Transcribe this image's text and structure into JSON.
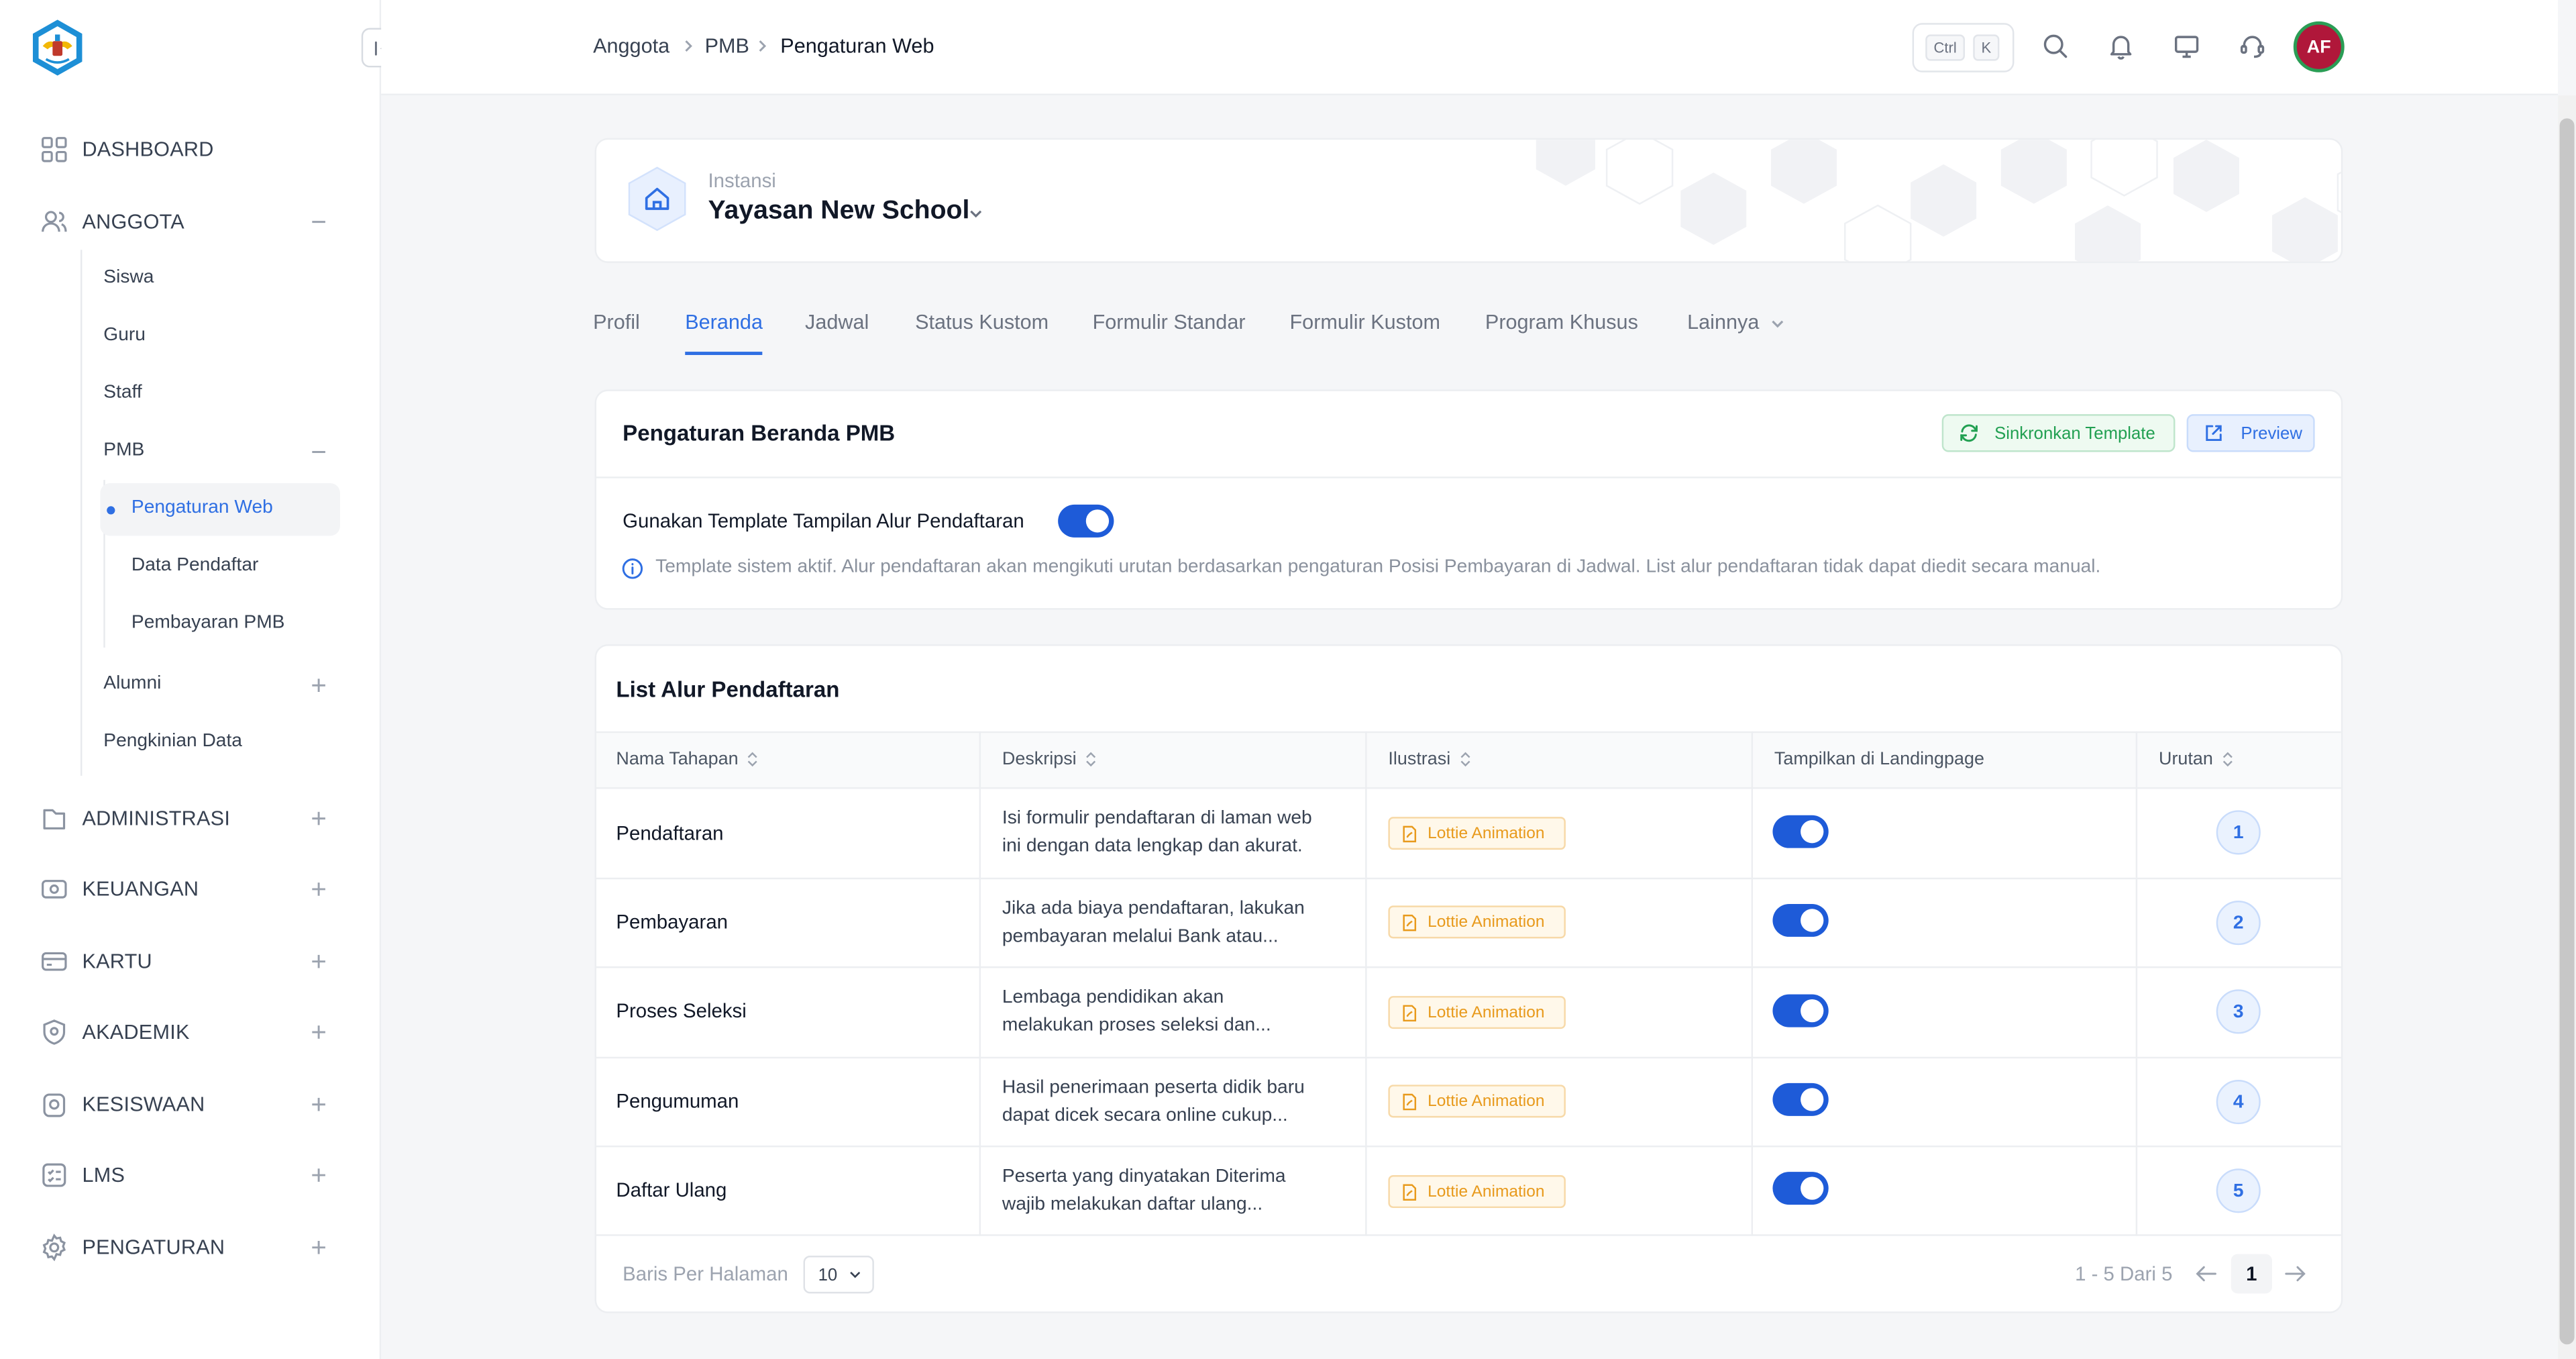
{
  "colors": {
    "primary": "#2f6fe3",
    "success": "#22a052",
    "warning": "#e89a1c",
    "avatar_bg": "#b0173a"
  },
  "sidebar": {
    "logo_icon": "tut-wuri-handayani-logo",
    "nav": [
      {
        "label": "DASHBOARD",
        "icon": "dashboard-icon"
      },
      {
        "label": "ANGGOTA",
        "icon": "users-icon",
        "expanded": true
      },
      {
        "label": "ADMINISTRASI",
        "icon": "folder-icon"
      },
      {
        "label": "KEUANGAN",
        "icon": "money-icon"
      },
      {
        "label": "KARTU",
        "icon": "card-icon"
      },
      {
        "label": "AKADEMIK",
        "icon": "shield-icon"
      },
      {
        "label": "KESISWAAN",
        "icon": "student-icon"
      },
      {
        "label": "LMS",
        "icon": "list-icon"
      },
      {
        "label": "PENGATURAN",
        "icon": "gear-icon"
      }
    ],
    "anggota_sub": [
      "Siswa",
      "Guru",
      "Staff",
      "PMB",
      "Alumni",
      "Pengkinian Data"
    ],
    "pmb_sub": [
      "Pengaturan Web",
      "Data Pendaftar",
      "Pembayaran PMB"
    ]
  },
  "header": {
    "breadcrumb": [
      "Anggota",
      "PMB",
      "Pengaturan Web"
    ],
    "shortcut": [
      "Ctrl",
      "K"
    ],
    "avatar_initials": "AF"
  },
  "instansi": {
    "label": "Instansi",
    "name": "Yayasan New School"
  },
  "tabs": [
    "Profil",
    "Beranda",
    "Jadwal",
    "Status Kustom",
    "Formulir Standar",
    "Formulir Kustom",
    "Program Khusus",
    "Lainnya"
  ],
  "active_tab": "Beranda",
  "settings": {
    "title": "Pengaturan Beranda PMB",
    "sync_label": "Sinkronkan Template",
    "preview_label": "Preview",
    "toggle_label": "Gunakan Template Tampilan Alur Pendaftaran",
    "toggle_on": true,
    "info": "Template sistem aktif. Alur pendaftaran akan mengikuti urutan berdasarkan pengaturan Posisi Pembayaran di Jadwal. List alur pendaftaran tidak dapat diedit secara manual."
  },
  "table": {
    "title": "List Alur Pendaftaran",
    "columns": [
      "Nama Tahapan",
      "Deskripsi",
      "Ilustrasi",
      "Tampilkan di Landingpage",
      "Urutan"
    ],
    "rows": [
      {
        "name": "Pendaftaran",
        "desc": [
          "Isi formulir pendaftaran di laman web",
          "ini dengan data lengkap dan akurat."
        ],
        "illustration": "Lottie Animation",
        "show": true,
        "order": "1"
      },
      {
        "name": "Pembayaran",
        "desc": [
          "Jika ada biaya pendaftaran, lakukan",
          "pembayaran melalui Bank atau..."
        ],
        "illustration": "Lottie Animation",
        "show": true,
        "order": "2"
      },
      {
        "name": "Proses Seleksi",
        "desc": [
          "Lembaga pendidikan akan",
          "melakukan proses seleksi dan..."
        ],
        "illustration": "Lottie Animation",
        "show": true,
        "order": "3"
      },
      {
        "name": "Pengumuman",
        "desc": [
          "Hasil penerimaan peserta didik baru",
          "dapat dicek secara online cukup..."
        ],
        "illustration": "Lottie Animation",
        "show": true,
        "order": "4"
      },
      {
        "name": "Daftar Ulang",
        "desc": [
          "Peserta yang dinyatakan Diterima",
          "wajib melakukan daftar ulang..."
        ],
        "illustration": "Lottie Animation",
        "show": true,
        "order": "5"
      }
    ]
  },
  "footer": {
    "per_page_label": "Baris Per Halaman",
    "per_page_value": "10",
    "range": "1 - 5 Dari 5",
    "current_page": "1"
  }
}
